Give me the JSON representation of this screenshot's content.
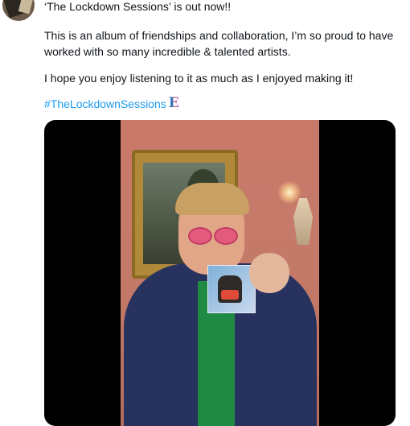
{
  "tweet": {
    "line1": "‘The Lockdown Sessions’ is out now!!",
    "para2": "This is an album of friendships and collaboration, I’m so proud to have worked with so many incredible & talented artists.",
    "para3": "I hope you enjoy listening to it as much as I enjoyed making it!",
    "hashtag": "#TheLockdownSessions",
    "hashtag_emoji_glyph": "E"
  },
  "colors": {
    "link": "#1d9bf0",
    "media_bg": "#000000",
    "text": "#0f1419"
  }
}
